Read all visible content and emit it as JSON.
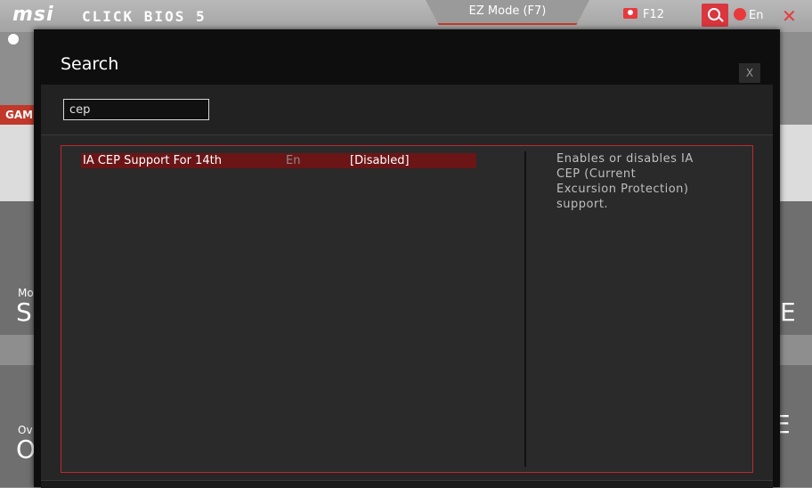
{
  "header": {
    "brand": "msi",
    "product": "CLICK BIOS 5",
    "mode_tab": "EZ Mode (F7)",
    "screenshot_label": "F12",
    "language": "En",
    "close_glyph": "✕"
  },
  "background": {
    "tab_label": "GAMI",
    "left_label_1": "Mo",
    "left_letter_1": "SI",
    "right_letter_1": "E",
    "left_label_2": "Ov",
    "left_letter_2": "O",
    "right_letter_2": "E"
  },
  "dialog": {
    "title": "Search",
    "close_label": "X",
    "search_value": "cep",
    "results": [
      {
        "name": "IA CEP Support For 14th",
        "abbr": "En",
        "value": "[Disabled]"
      }
    ],
    "help_text": "Enables or disables IA CEP (Current Excursion Protection) support."
  }
}
